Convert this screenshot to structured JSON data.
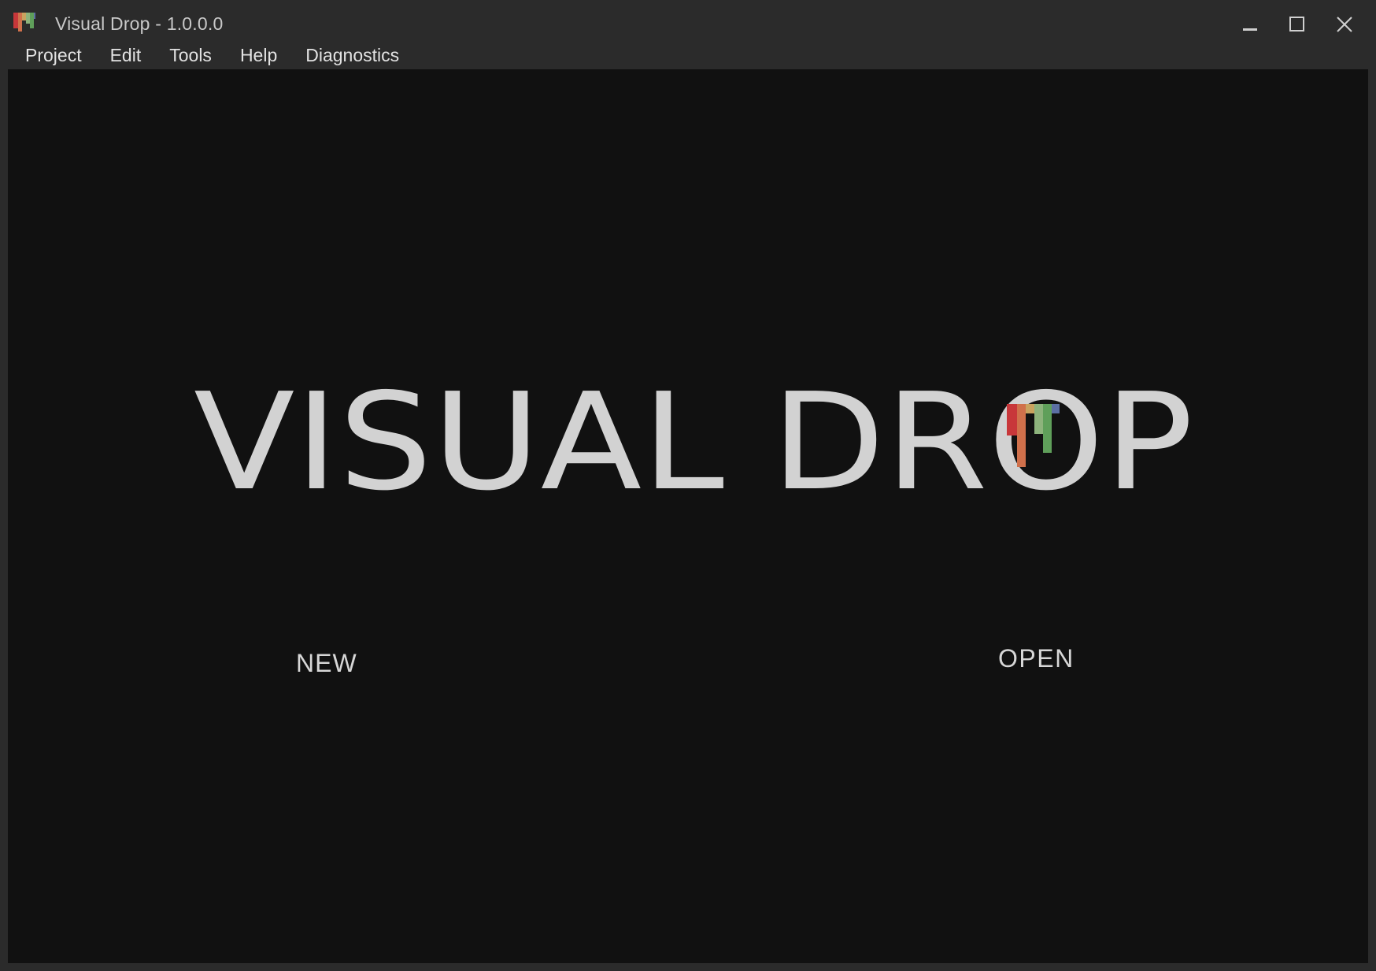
{
  "window": {
    "title": "Visual Drop - 1.0.0.0"
  },
  "menu": [
    "Project",
    "Edit",
    "Tools",
    "Help",
    "Diagnostics"
  ],
  "logo": {
    "text": "VISUAL DROP",
    "drip_colors": [
      "#c8373a",
      "#d0704b",
      "#c9a35f",
      "#8db37c",
      "#5f9f5a",
      "#5c6fa3"
    ]
  },
  "actions": {
    "new_label": "NEW",
    "open_label": "OPEN"
  },
  "colors": {
    "background": "#111111",
    "chrome": "#2b2b2b",
    "text": "#d2d2d2"
  }
}
